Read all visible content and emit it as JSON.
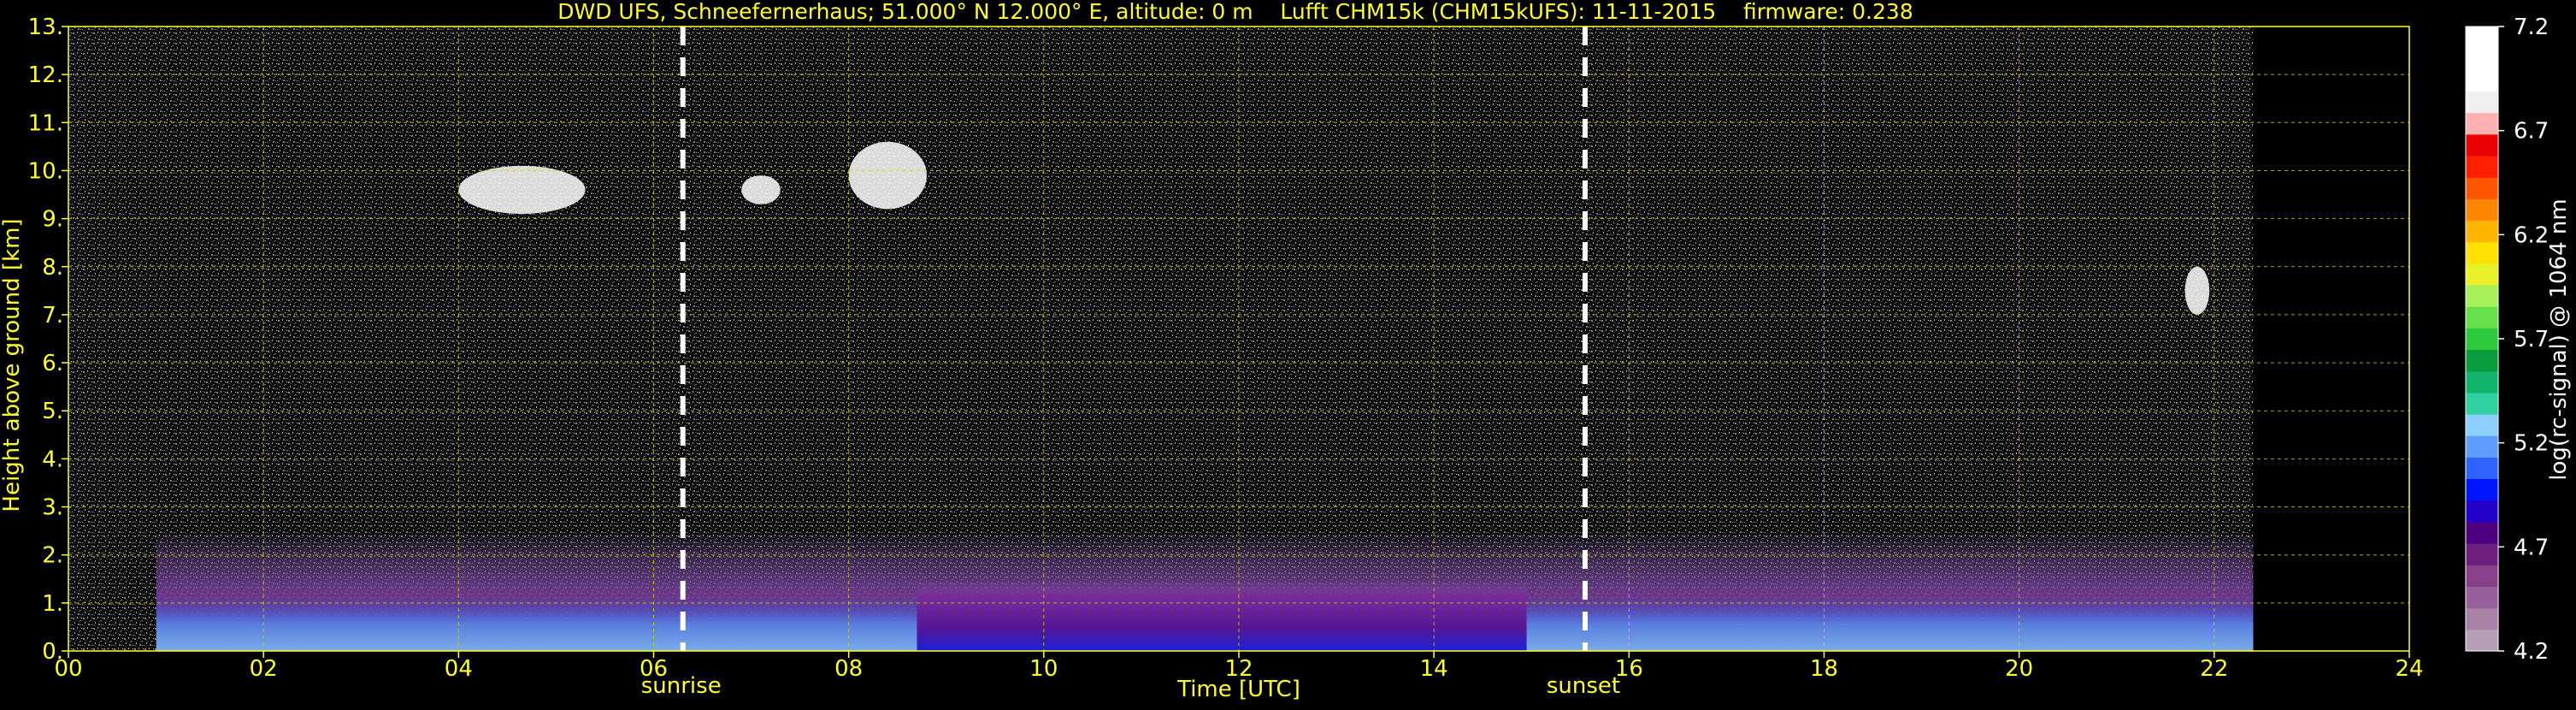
{
  "chart_data": {
    "type": "heatmap",
    "title": "DWD UFS, Schneefernerhaus; 51.000° N 12.000° E, altitude: 0 m    Lufft CHM15k (CHM15kUFS): 11-11-2015    firmware: 0.238",
    "xlabel": "Time [UTC]",
    "ylabel": "Height above ground [km]",
    "colorbar_label": "log(rc-signal) @ 1064 nm",
    "xlim": [
      0,
      24
    ],
    "ylim": [
      0,
      13
    ],
    "x_ticks": [
      "00",
      "02",
      "04",
      "06",
      "08",
      "10",
      "12",
      "14",
      "16",
      "18",
      "20",
      "22",
      "24"
    ],
    "y_ticks": [
      "0.",
      "1.",
      "2.",
      "3.",
      "4.",
      "5.",
      "6.",
      "7.",
      "8.",
      "9.",
      "10.",
      "11.",
      "12.",
      "13."
    ],
    "grid": true,
    "data_end_hour": 22.4,
    "events": [
      {
        "label": "sunrise",
        "hour": 6.3
      },
      {
        "label": "sunset",
        "hour": 15.55
      }
    ],
    "colorbar": {
      "min": 4.2,
      "max": 7.2,
      "ticks": [
        "4.2",
        "4.7",
        "5.2",
        "5.7",
        "6.2",
        "6.7",
        "7.2"
      ],
      "colors": [
        "#b7a0b7",
        "#a77fa7",
        "#97609a",
        "#873f8a",
        "#6d1f7d",
        "#4b0082",
        "#2200c8",
        "#0015ff",
        "#2d64ff",
        "#5c9cff",
        "#8ccfff",
        "#30d0a0",
        "#12b26a",
        "#0b9a3b",
        "#2ac83a",
        "#66e04a",
        "#a6f05a",
        "#e8f02a",
        "#ffe100",
        "#ffb400",
        "#ff8400",
        "#ff5500",
        "#ff2000",
        "#e80000",
        "#ffb0b0",
        "#f0f0f0",
        "#ffffff",
        "#ffffff",
        "#ffffff"
      ]
    },
    "features": [
      {
        "kind": "boundary_layer",
        "start_hour": 0.9,
        "end_hour": 22.4,
        "top_km": 2.5,
        "color": "#9a6fcf"
      },
      {
        "kind": "dense_aerosol_layer",
        "start_hour": 8.7,
        "end_hour": 14.95,
        "top_km": 1.45,
        "color": "#5a0f8f"
      },
      {
        "kind": "ice_cloud",
        "start_hour": 4.0,
        "end_hour": 5.3,
        "bottom_km": 9.1,
        "top_km": 10.1
      },
      {
        "kind": "ice_cloud",
        "start_hour": 6.9,
        "end_hour": 7.3,
        "bottom_km": 9.3,
        "top_km": 9.9
      },
      {
        "kind": "ice_cloud",
        "start_hour": 8.0,
        "end_hour": 8.8,
        "bottom_km": 9.2,
        "top_km": 10.6
      },
      {
        "kind": "ice_cloud",
        "start_hour": 21.7,
        "end_hour": 21.95,
        "bottom_km": 7.0,
        "top_km": 8.0
      }
    ]
  }
}
